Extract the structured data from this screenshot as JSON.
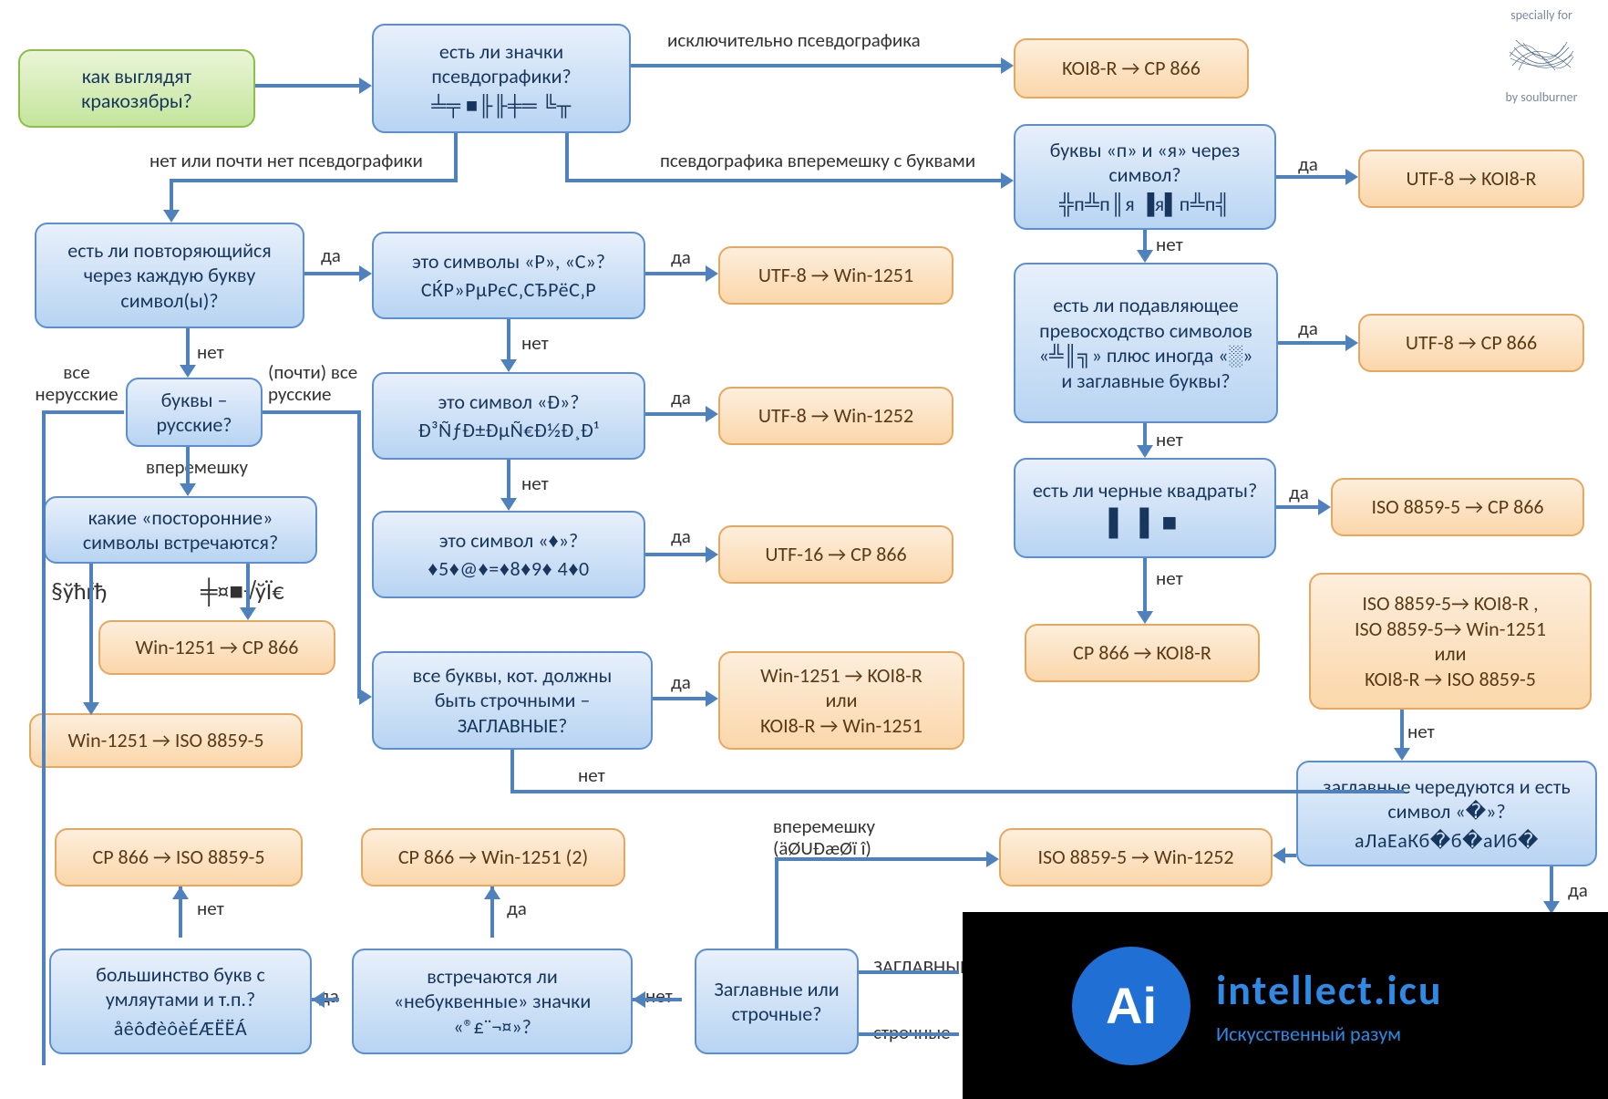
{
  "watermark": {
    "top": "specially for",
    "bottom": "by soulburner"
  },
  "overlay": {
    "badge": "Ai",
    "line1": "intellect.icu",
    "line2": "Искусственный разум"
  },
  "start": {
    "text": "как выглядят кракозябры?"
  },
  "q_pseudo": {
    "text": "есть ли значки псевдографики?",
    "sample": "╧╤ ■╟╟╪═ ╚╥"
  },
  "lbl_only_pseudo": "исключительно псевдографика",
  "r_koi8_cp866": "KOI8-R → CP 866",
  "lbl_mixed": "псевдографика вперемешку с буквами",
  "lbl_no_pseudo": "нет или почти нет псевдографики",
  "q_p_ya": {
    "text": "буквы «п» и «я» через символ?",
    "sample": "╬п╩п║я ▐я▌п╩п╣"
  },
  "r_utf8_koi8": "UTF-8 → KOI8-R",
  "q_repeat": {
    "text": "есть ли повторяющийся через каждую букву символ(ы)?"
  },
  "q_rc": {
    "text": "это символы «Р», «С»?",
    "sample": "СЌР»РµРєС‚СЂРёС‚Р"
  },
  "r_utf8_win1251": "UTF-8 → Win-1251",
  "q_preobl": {
    "text": "есть ли подавляющее превосходство символов «╩║╗» плюс иногда «░» и заглавные буквы?"
  },
  "r_utf8_cp866": "UTF-8 → CP 866",
  "q_d": {
    "text": "это символ «Ð»?",
    "sample": "Ð³ÑƒÐ±ÐµÑ€Ð½Đ¸Đ¹"
  },
  "r_utf8_win1252": "UTF-8 → Win-1252",
  "q_blacksq": {
    "text": "есть ли черные квадраты?",
    "sample": "▌▐ ■"
  },
  "r_iso_cp866": "ISO 8859-5 → CP 866",
  "q_diamond": {
    "text": "это символ «♦»?",
    "sample": "♦5♦@♦=♦8♦9♦ 4♦0"
  },
  "r_utf16_cp866": "UTF-16 → CP 866",
  "r_cp866_koi8": "CP 866 → KOI8-R",
  "q_russian": {
    "text": "буквы – русские?"
  },
  "lbl_all_nonrus": "все нерусские",
  "lbl_all_rus": "(почти) все русские",
  "lbl_mix": "вперемешку",
  "q_foreign": {
    "text": "какие «посторонние» символы встречаются?"
  },
  "sample_left": "§ўħŕђ",
  "sample_right": "╪¤■√ўÏ€",
  "r_win1251_cp866": "Win-1251 → CP 866",
  "r_win1251_iso": "Win-1251 → ISO 8859-5",
  "q_caps": {
    "text": "все буквы, кот. должны быть строчными – ЗАГЛАВНЫЕ?"
  },
  "r_win_koi_or": "Win-1251 → KOI8-R\nили\nKOI8-R → Win-1251",
  "r_iso_block": "ISO 8859-5→ KOI8-R ,\nISO 8859-5→ Win-1251\nили\nKOI8-R → ISO 8859-5",
  "q_altern": {
    "text": "заглавные чередуются и есть символ «�»?",
    "sample": "аЛаЕаКб�б�аИб�"
  },
  "r_iso_win1252": "ISO 8859-5  → Win-1252",
  "r_cp866_iso": "CP 866 → ISO 8859-5",
  "r_cp866_win1251": "CP 866 → Win-1251 (2)",
  "q_umlaut": {
    "text": "большинство букв с умляутами и т.п.?",
    "sample": "åêôđèôèÉÆËЁÁ"
  },
  "q_nonletter": {
    "text": "встречаются ли «небуквенные» значки «®£¨¬¤»?"
  },
  "q_case": {
    "text": "Заглавные или строчные?"
  },
  "lbl_da": "да",
  "lbl_net": "нет",
  "lbl_zagl": "ЗАГЛАВНЫЕ",
  "lbl_stroch": "строчные",
  "lbl_vperem": "вперемешку\n(äØUÐæØï î)"
}
